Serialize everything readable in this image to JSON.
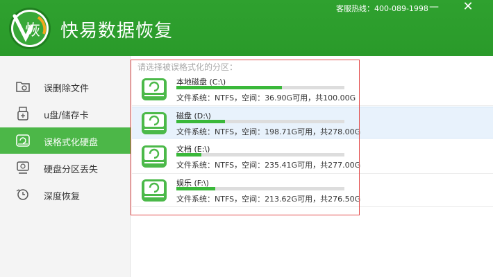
{
  "app": {
    "logo_char": "恢",
    "title": "快易数据恢复",
    "hotline": "客服热线：400-089-1998"
  },
  "window_controls": {
    "minimize": "—",
    "close": "✕"
  },
  "colors": {
    "brand_green": "#2fa12f",
    "active_green": "#4cb748",
    "progress_green": "#3ab83a",
    "highlight_red": "#e24848",
    "selected_blue": "#e8f2fc"
  },
  "sidebar": {
    "items": [
      {
        "label": "误删除文件",
        "icon": "folder-recycle-icon",
        "active": false
      },
      {
        "label": "u盘/储存卡",
        "icon": "usb-drive-icon",
        "active": false
      },
      {
        "label": "误格式化硬盘",
        "icon": "hard-disk-refresh-icon",
        "active": true
      },
      {
        "label": "硬盘分区丢失",
        "icon": "disk-partition-icon",
        "active": false
      },
      {
        "label": "深度恢复",
        "icon": "deep-scan-clock-icon",
        "active": false
      }
    ]
  },
  "main": {
    "prompt": "请选择被误格式化的分区：",
    "partitions": [
      {
        "name": "本地磁盘 (C:\\)",
        "info": "文件系统：NTFS，空间：36.90G可用，共100.00G",
        "used_fraction": 0.63,
        "selected": false
      },
      {
        "name": "磁盘 (D:\\)",
        "info": "文件系统：NTFS，空间：198.71G可用，共278.00G",
        "used_fraction": 0.29,
        "selected": true
      },
      {
        "name": "文档 (E:\\)",
        "info": "文件系统：NTFS，空间：235.41G可用，共277.00G",
        "used_fraction": 0.15,
        "selected": false
      },
      {
        "name": "娱乐 (F:\\)",
        "info": "文件系统：NTFS，空间：213.62G可用，共276.50G",
        "used_fraction": 0.23,
        "selected": false
      }
    ]
  }
}
